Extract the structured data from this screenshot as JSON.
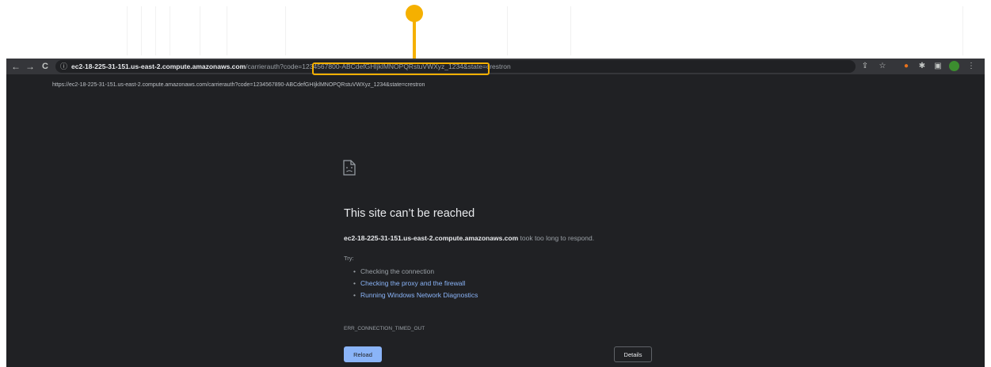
{
  "toolbar": {
    "back_icon": "back-arrow-icon",
    "forward_icon": "forward-arrow-icon",
    "reload_icon": "reload-icon",
    "back_glyph": "←",
    "forward_glyph": "→",
    "reload_glyph": "C"
  },
  "omnibox": {
    "info_glyph": "ⓘ",
    "url_host": "ec2-18-225-31-151.us-east-2.compute.amazonaws.com",
    "url_path": "/carrierauth?code=",
    "url_code": "1234567800-ABCdefGHIjklMNOPQRstuVWXyz_1234",
    "url_tail": "&state=crestron"
  },
  "extensions": {
    "share_glyph": "⇪",
    "star_glyph": "☆",
    "ext1_glyph": "●",
    "puzzle_glyph": "✱",
    "sidepanel_glyph": "▣",
    "menu_glyph": "⋮",
    "profile_color": "#3c8d2f"
  },
  "page": {
    "full_url": "https://ec2-18-225-31-151.us-east-2.compute.amazonaws.com/carrierauth?code=1234567890-ABCdefGHIjklMNOPQRstuVWXyz_1234&state=crestron",
    "title": "This site can’t be reached",
    "host": "ec2-18-225-31-151.us-east-2.compute.amazonaws.com",
    "message": " took too long to respond.",
    "try_label": "Try:",
    "suggestions": [
      {
        "text": "Checking the connection",
        "link": false
      },
      {
        "text": "Checking the proxy and the firewall",
        "link": true
      },
      {
        "text": "Running Windows Network Diagnostics",
        "link": true
      }
    ],
    "error_code": "ERR_CONNECTION_TIMED_OUT",
    "reload_label": "Reload",
    "details_label": "Details"
  },
  "colors": {
    "callout": "#f5b000",
    "link": "#8ab4f8",
    "background": "#202124"
  }
}
